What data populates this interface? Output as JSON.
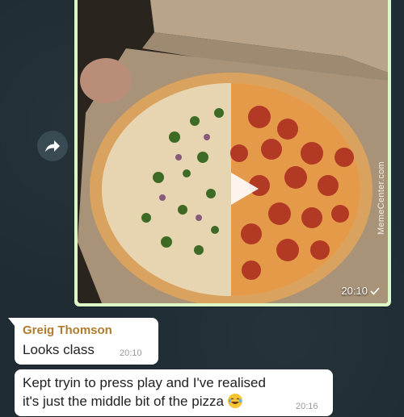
{
  "media_message": {
    "time": "20:10",
    "status_icon": "check-icon",
    "watermark": "MemeCenter.com"
  },
  "messages": [
    {
      "sender": "Greig Thomson",
      "text": "Looks class",
      "time": "20:10"
    },
    {
      "text_line1": "Kept tryin to press play and I've realised",
      "text_line2": "it's just the middle bit of the pizza",
      "emoji": "laughing-crying-emoji",
      "time": "20:16"
    }
  ],
  "colors": {
    "background": "#1f2c34",
    "outgoing_bubble": "#dcf8c6",
    "incoming_bubble": "#ffffff",
    "sender_name": "#b07b2c"
  }
}
